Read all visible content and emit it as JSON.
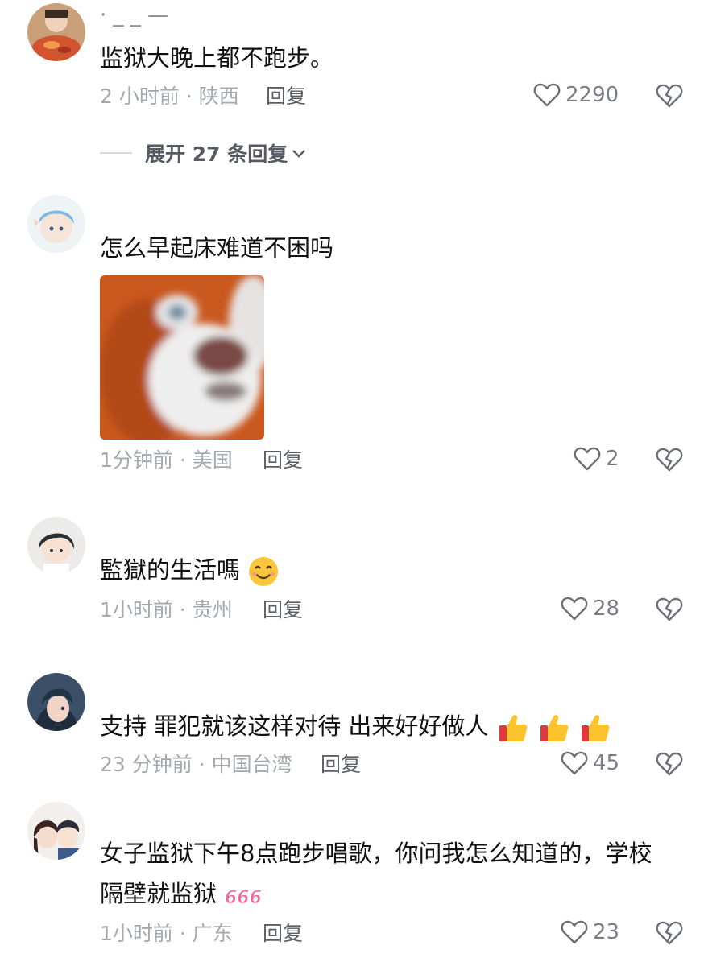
{
  "comments": [
    {
      "username": "· _ _ —",
      "text": "监狱大晚上都不跑步。",
      "time_location": "2 小时前 · 陕西",
      "reply_label": "回复",
      "likes": "2290",
      "avatar_icon": "food-photo-avatar-icon",
      "expand_label": "展开 27 条回复"
    },
    {
      "text": "怎么早起床难道不困吗",
      "time_location": "1分钟前 · 美国",
      "reply_label": "回复",
      "likes": "2",
      "avatar_icon": "anime-character-avatar-icon",
      "sticker": "monkey-face-sticker"
    },
    {
      "text": "監獄的生活嗎",
      "time_location": "1小时前 · 贵州",
      "reply_label": "回复",
      "likes": "28",
      "avatar_icon": "anime-boy-avatar-icon",
      "emoji": "smiling-face-emoji"
    },
    {
      "text": "支持 罪犯就该这样对待 出来好好做人",
      "time_location": "23 分钟前 · 中国台湾",
      "reply_label": "回复",
      "likes": "45",
      "avatar_icon": "anime-girl-avatar-icon",
      "emoji": "thumbs-up-emoji"
    },
    {
      "text_line1": "女子监狱下午8点跑步唱歌，你问我怎么知道的，学校",
      "text_line2": "隔壁就监狱",
      "time_location": "1小时前 · 广东",
      "reply_label": "回复",
      "likes": "23",
      "avatar_icon": "couple-avatar-icon",
      "emoji": "666-emoji"
    }
  ],
  "colors": {
    "text": "#111111",
    "meta": "#a5a8ae",
    "reply": "#5a5e66",
    "icon": "#6b6f78"
  }
}
